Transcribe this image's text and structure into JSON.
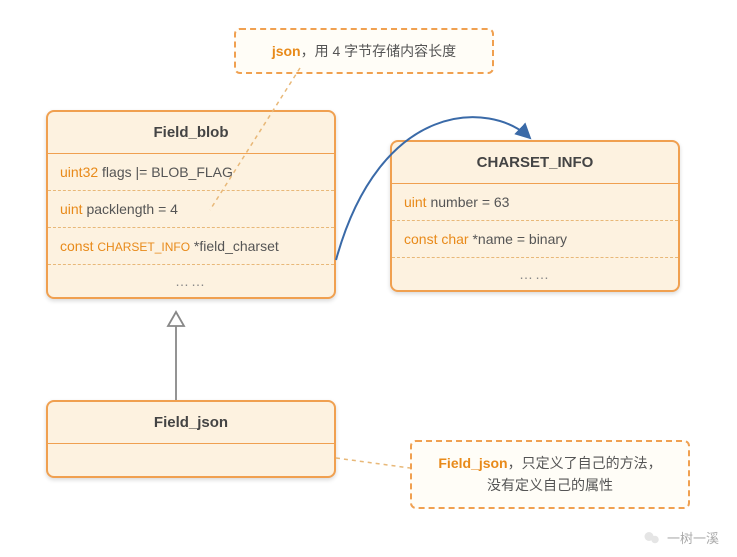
{
  "callout_top": {
    "highlight": "json",
    "text": "，用 4 字节存储内容长度"
  },
  "field_blob": {
    "title": "Field_blob",
    "rows": {
      "r1_kw": "uint32",
      "r1_rest": " flags |= BLOB_FLAG",
      "r2_kw": "uint",
      "r2_rest": " packlength = 4",
      "r3_kw": "const ",
      "r3_sc": "CHARSET_INFO",
      "r3_rest": " *field_charset",
      "ellipsis": "……"
    }
  },
  "charset_info": {
    "title": "CHARSET_INFO",
    "rows": {
      "r1_kw": "uint",
      "r1_rest": " number = 63",
      "r2_kw": "const char",
      "r2_rest": " *name = binary",
      "ellipsis": "……"
    }
  },
  "field_json": {
    "title": "Field_json"
  },
  "callout_bottom": {
    "highlight": "Field_json",
    "line1_rest": "，只定义了自己的方法，",
    "line2": "没有定义自己的属性"
  },
  "watermark": "一树一溪"
}
